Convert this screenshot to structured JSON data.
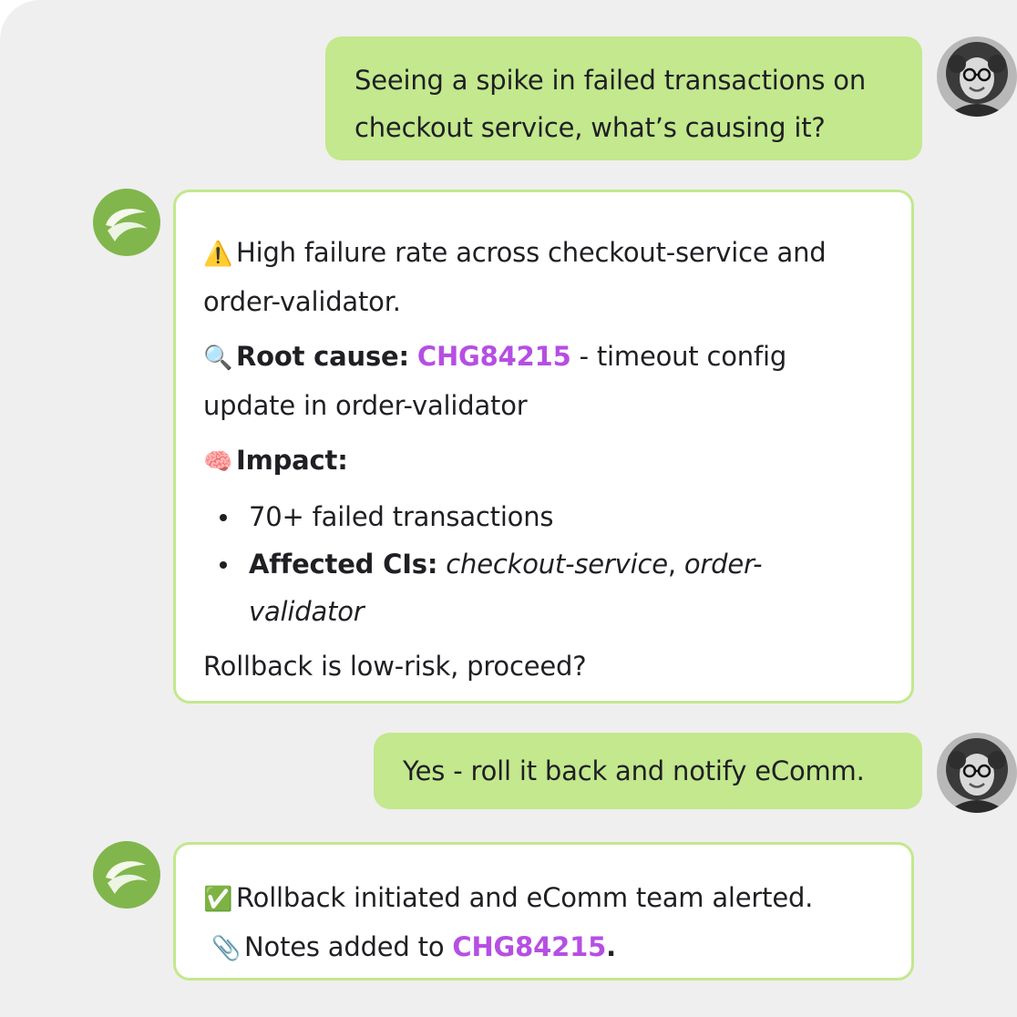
{
  "messages": {
    "user1": {
      "line1": "Seeing a spike in failed transactions on",
      "line2": "checkout service, what’s causing it?"
    },
    "bot1": {
      "warning_emoji": "⚠️",
      "summary_line1": "High failure rate across checkout-service and",
      "summary_line2": "order-validator.",
      "root_emoji": "🔍",
      "root_label": "Root cause:",
      "root_link": "CHG84215",
      "root_text_line1": " - timeout config",
      "root_text_line2": "update in order-validator",
      "impact_emoji": "🧠",
      "impact_label": "Impact:",
      "bullet1": "70+ failed transactions",
      "bullet2_label": "Affected CIs:",
      "bullet2_ci1": "checkout-service",
      "bullet2_sep": ", ",
      "bullet2_ci2_part1": "order-",
      "bullet2_ci2_part2": "validator",
      "question": "Rollback is low-risk, proceed?"
    },
    "user2": {
      "text": "Yes - roll it back and notify eComm."
    },
    "bot2": {
      "check_emoji": "✅",
      "line1": "Rollback initiated and eComm team alerted.",
      "clip_emoji": "📎",
      "line2_prefix": "Notes added to ",
      "line2_link": "CHG84215",
      "line2_suffix": "."
    }
  },
  "colors": {
    "background": "#efefef",
    "user_bubble": "#c3e88d",
    "bot_border": "#c3e88d",
    "bot_logo": "#81b64c",
    "link": "#b54fe3"
  },
  "icons": {
    "user_avatar": "user-avatar-photo",
    "bot_logo": "green-leaf-logo"
  }
}
